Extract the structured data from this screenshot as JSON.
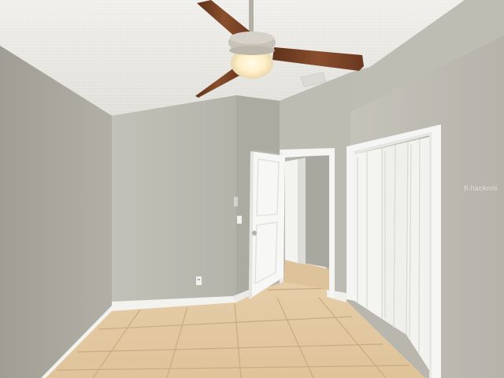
{
  "scene": {
    "description_free": true,
    "colors": {
      "ceiling": "#ecebe7",
      "wall_left": "#a9a79e",
      "wall_back": "#b9b8af",
      "wall_right": "#bcbab1",
      "trim": "#f4f4f2",
      "floor": "#e3c9a2",
      "grout": "#c9ae86",
      "fan_blade": "#7a4426",
      "fan_body": "#c9c4ba",
      "light": "#fff3d2"
    },
    "icons": [
      "ceiling-fan-icon",
      "door-knob-icon",
      "outlet-icon"
    ]
  },
  "watermark": {
    "text": "fl-hackmls"
  }
}
